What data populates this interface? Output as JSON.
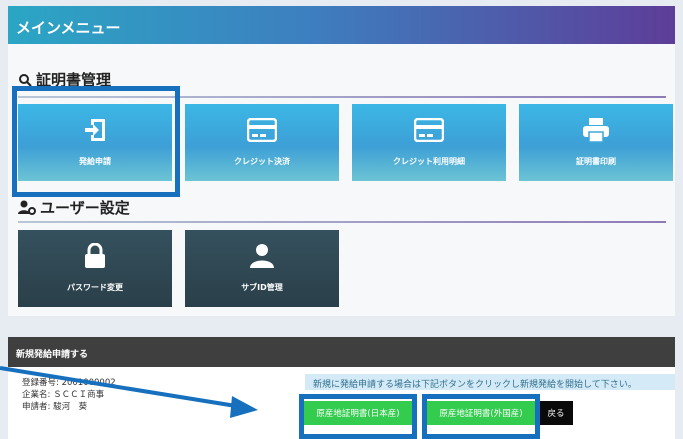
{
  "header": {
    "title": "メインメニュー"
  },
  "certificate_section": {
    "title": "証明書管理",
    "tiles": [
      {
        "label": "発給申請",
        "icon": "sign-in-icon"
      },
      {
        "label": "クレジット決済",
        "icon": "credit-card-icon"
      },
      {
        "label": "クレジット利用明細",
        "icon": "credit-card-icon"
      },
      {
        "label": "証明書印刷",
        "icon": "printer-icon"
      }
    ]
  },
  "user_section": {
    "title": "ユーザー設定",
    "tiles": [
      {
        "label": "パスワード変更",
        "icon": "lock-icon"
      },
      {
        "label": "サブID管理",
        "icon": "user-icon"
      }
    ]
  },
  "new_application": {
    "title": "新規発給申請する",
    "info": {
      "member_no": "登録番号: 2001000002",
      "company": "企業名: ＳＣＣＩ商事",
      "applicant": "申請者: 駿河　葵"
    },
    "notice": "新規に発給申請する場合は下記ボタンをクリックし新規発給を開始して下さい。",
    "buttons": {
      "japan": "原産地証明書(日本産)",
      "foreign": "原産地証明書(外国産)",
      "back": "戻る"
    }
  },
  "colors": {
    "accent_blue": "#1670bd",
    "tile_blue": "#3bb7e6",
    "tile_dark": "#2f4853",
    "button_green": "#34cc4f"
  }
}
